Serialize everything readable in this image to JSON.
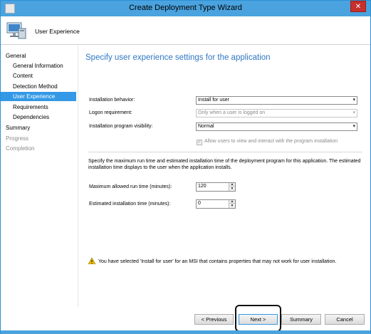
{
  "window": {
    "title": "Create Deployment Type Wizard",
    "close_glyph": "✕",
    "accent_color": "#4aa3df"
  },
  "header": {
    "title": "User Experience",
    "icon": "computer-monitor-icon"
  },
  "nav": {
    "items": [
      {
        "label": "General",
        "level": 0,
        "state": "normal"
      },
      {
        "label": "General Information",
        "level": 1,
        "state": "normal"
      },
      {
        "label": "Content",
        "level": 1,
        "state": "normal"
      },
      {
        "label": "Detection Method",
        "level": 1,
        "state": "normal"
      },
      {
        "label": "User Experience",
        "level": 1,
        "state": "active"
      },
      {
        "label": "Requirements",
        "level": 1,
        "state": "normal"
      },
      {
        "label": "Dependencies",
        "level": 1,
        "state": "normal"
      },
      {
        "label": "Summary",
        "level": 0,
        "state": "normal"
      },
      {
        "label": "Progress",
        "level": 0,
        "state": "disabled"
      },
      {
        "label": "Completion",
        "level": 0,
        "state": "disabled"
      }
    ]
  },
  "main": {
    "title": "Specify user experience settings for the application",
    "installation_behavior": {
      "label": "Installation behavior:",
      "value": "Install for user"
    },
    "logon_requirement": {
      "label": "Logon requirement:",
      "value": "Only when a user is logged on"
    },
    "program_visibility": {
      "label": "Installation program visibility:",
      "value": "Normal"
    },
    "allow_interact": {
      "label": "Allow users to view and interact with the program installation",
      "checked": true
    },
    "description": "Specify the maximum run time and estimated installation time of the deployment program for this application.  The estimated installation time displays to the user when the application installs.",
    "max_run_time": {
      "label": "Maximum allowed run time (minutes):",
      "value": "120"
    },
    "estimated_time": {
      "label": "Estimated installation time (minutes):",
      "value": "0"
    },
    "warning": "You have selected 'Install for user' for an MSI that contains properties that may not work for user installation."
  },
  "footer": {
    "previous": "< Previous",
    "next": "Next >",
    "summary": "Summary",
    "cancel": "Cancel"
  }
}
